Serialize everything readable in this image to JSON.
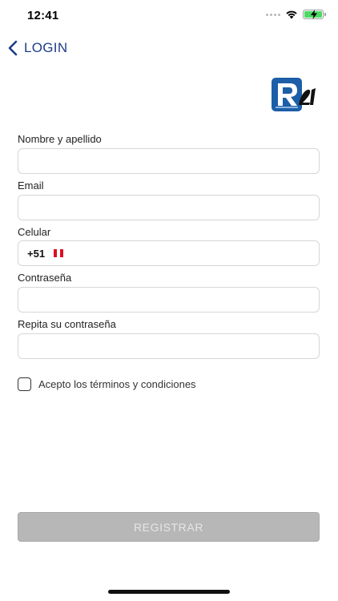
{
  "status_bar": {
    "time": "12:41",
    "icons": [
      "signal-icon",
      "wifi-icon",
      "battery-charging-icon"
    ]
  },
  "nav": {
    "back_label": "LOGIN",
    "accent_color": "#1f3c88"
  },
  "form": {
    "full_name": {
      "label": "Nombre y apellido",
      "value": "",
      "placeholder": ""
    },
    "email": {
      "label": "Email",
      "value": "",
      "placeholder": ""
    },
    "phone": {
      "label": "Celular",
      "prefix": "+51",
      "country_flag": "peru-flag-icon",
      "value": ""
    },
    "password": {
      "label": "Contraseña",
      "value": "",
      "placeholder": ""
    },
    "password_confirm": {
      "label": "Repita su contraseña",
      "value": "",
      "placeholder": ""
    },
    "terms": {
      "label": "Acepto los términos y condiciones",
      "checked": false
    }
  },
  "register_button": {
    "label": "REGISTRAR",
    "enabled": false,
    "color": "#b7b7b7"
  }
}
